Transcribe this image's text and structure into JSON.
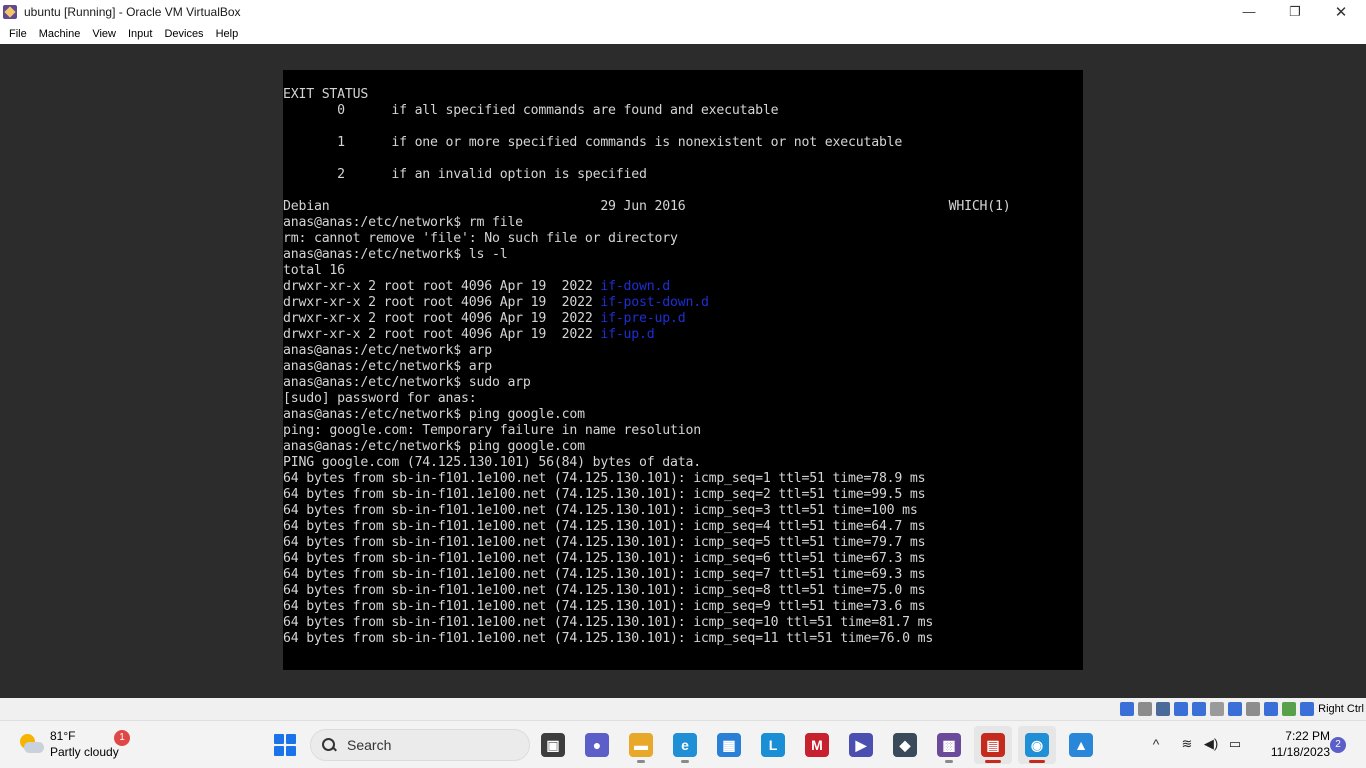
{
  "window": {
    "title": "ubuntu [Running] - Oracle VM VirtualBox",
    "minimize": "—",
    "maximize": "❐",
    "close": "✕"
  },
  "menu": [
    "File",
    "Machine",
    "View",
    "Input",
    "Devices",
    "Help"
  ],
  "terminal": {
    "lines": [
      "EXIT STATUS",
      "       0      if all specified commands are found and executable",
      "",
      "       1      if one or more specified commands is nonexistent or not executable",
      "",
      "       2      if an invalid option is specified",
      "",
      "Debian                                   29 Jun 2016                                  WHICH(1)",
      "anas@anas:/etc/network$ rm file",
      "rm: cannot remove 'file': No such file or directory",
      "anas@anas:/etc/network$ ls -l",
      "total 16",
      [
        "drwxr-xr-x 2 root root 4096 Apr 19  2022 ",
        "if-down.d"
      ],
      [
        "drwxr-xr-x 2 root root 4096 Apr 19  2022 ",
        "if-post-down.d"
      ],
      [
        "drwxr-xr-x 2 root root 4096 Apr 19  2022 ",
        "if-pre-up.d"
      ],
      [
        "drwxr-xr-x 2 root root 4096 Apr 19  2022 ",
        "if-up.d"
      ],
      "anas@anas:/etc/network$ arp",
      "anas@anas:/etc/network$ arp",
      "anas@anas:/etc/network$ sudo arp",
      "[sudo] password for anas:",
      "anas@anas:/etc/network$ ping google.com",
      "ping: google.com: Temporary failure in name resolution",
      "anas@anas:/etc/network$ ping google.com",
      "PING google.com (74.125.130.101) 56(84) bytes of data.",
      "64 bytes from sb-in-f101.1e100.net (74.125.130.101): icmp_seq=1 ttl=51 time=78.9 ms",
      "64 bytes from sb-in-f101.1e100.net (74.125.130.101): icmp_seq=2 ttl=51 time=99.5 ms",
      "64 bytes from sb-in-f101.1e100.net (74.125.130.101): icmp_seq=3 ttl=51 time=100 ms",
      "64 bytes from sb-in-f101.1e100.net (74.125.130.101): icmp_seq=4 ttl=51 time=64.7 ms",
      "64 bytes from sb-in-f101.1e100.net (74.125.130.101): icmp_seq=5 ttl=51 time=79.7 ms",
      "64 bytes from sb-in-f101.1e100.net (74.125.130.101): icmp_seq=6 ttl=51 time=67.3 ms",
      "64 bytes from sb-in-f101.1e100.net (74.125.130.101): icmp_seq=7 ttl=51 time=69.3 ms",
      "64 bytes from sb-in-f101.1e100.net (74.125.130.101): icmp_seq=8 ttl=51 time=75.0 ms",
      "64 bytes from sb-in-f101.1e100.net (74.125.130.101): icmp_seq=9 ttl=51 time=73.6 ms",
      "64 bytes from sb-in-f101.1e100.net (74.125.130.101): icmp_seq=10 ttl=51 time=81.7 ms",
      "64 bytes from sb-in-f101.1e100.net (74.125.130.101): icmp_seq=11 ttl=51 time=76.0 ms"
    ],
    "directory_color": "#1d2fd3"
  },
  "status_bar": {
    "host_key": "Right Ctrl",
    "icons": [
      "hard-disk-icon",
      "optical-drive-icon",
      "audio-icon",
      "network-icon",
      "usb-icon",
      "shared-folder-icon",
      "display-icon",
      "video-capture-icon",
      "cpu-icon",
      "mouse-integration-icon",
      "keyboard-icon"
    ],
    "icon_colors": [
      "#3a6fd8",
      "#8c8c8c",
      "#4a6a9a",
      "#3a6fd8",
      "#3a6fd8",
      "#9a9a9a",
      "#3a6fd8",
      "#8c8c8c",
      "#3a6fd8",
      "#58a04a",
      "#3a6fd8"
    ]
  },
  "taskbar": {
    "weather": {
      "temp": "81°F",
      "condition": "Partly cloudy",
      "badge": "1"
    },
    "search_label": "Search",
    "apps": [
      {
        "name": "task-view-icon",
        "glyph": "▣",
        "color": "#3d3d3d"
      },
      {
        "name": "teams-chat-icon",
        "glyph": "●",
        "color": "#5b5fc7"
      },
      {
        "name": "file-explorer-icon",
        "glyph": "▬",
        "color": "#e8a82a"
      },
      {
        "name": "edge-icon",
        "glyph": "e",
        "color": "#1f8fd6"
      },
      {
        "name": "microsoft-store-icon",
        "glyph": "▦",
        "color": "#2a7fd6"
      },
      {
        "name": "app-l-icon",
        "glyph": "L",
        "color": "#1a8fd6"
      },
      {
        "name": "mcafee-icon",
        "glyph": "M",
        "color": "#c7202f"
      },
      {
        "name": "media-app-icon",
        "glyph": "▶",
        "color": "#4b4fb0"
      },
      {
        "name": "cube-app-icon",
        "glyph": "◆",
        "color": "#3a4a5a"
      },
      {
        "name": "virtualbox-icon",
        "glyph": "▩",
        "color": "#6b4a9a"
      },
      {
        "name": "remote-app-icon",
        "glyph": "▤",
        "color": "#c42b1c"
      },
      {
        "name": "chat-app-icon",
        "glyph": "◉",
        "color": "#1f8fd6"
      },
      {
        "name": "photos-icon",
        "glyph": "▲",
        "color": "#2a86d8"
      }
    ],
    "tray_chevron": "^",
    "wifi_glyph": "≋",
    "volume_glyph": "◀)",
    "battery_glyph": "▭",
    "time": "7:22 PM",
    "date": "11/18/2023",
    "notification_count": "2"
  }
}
